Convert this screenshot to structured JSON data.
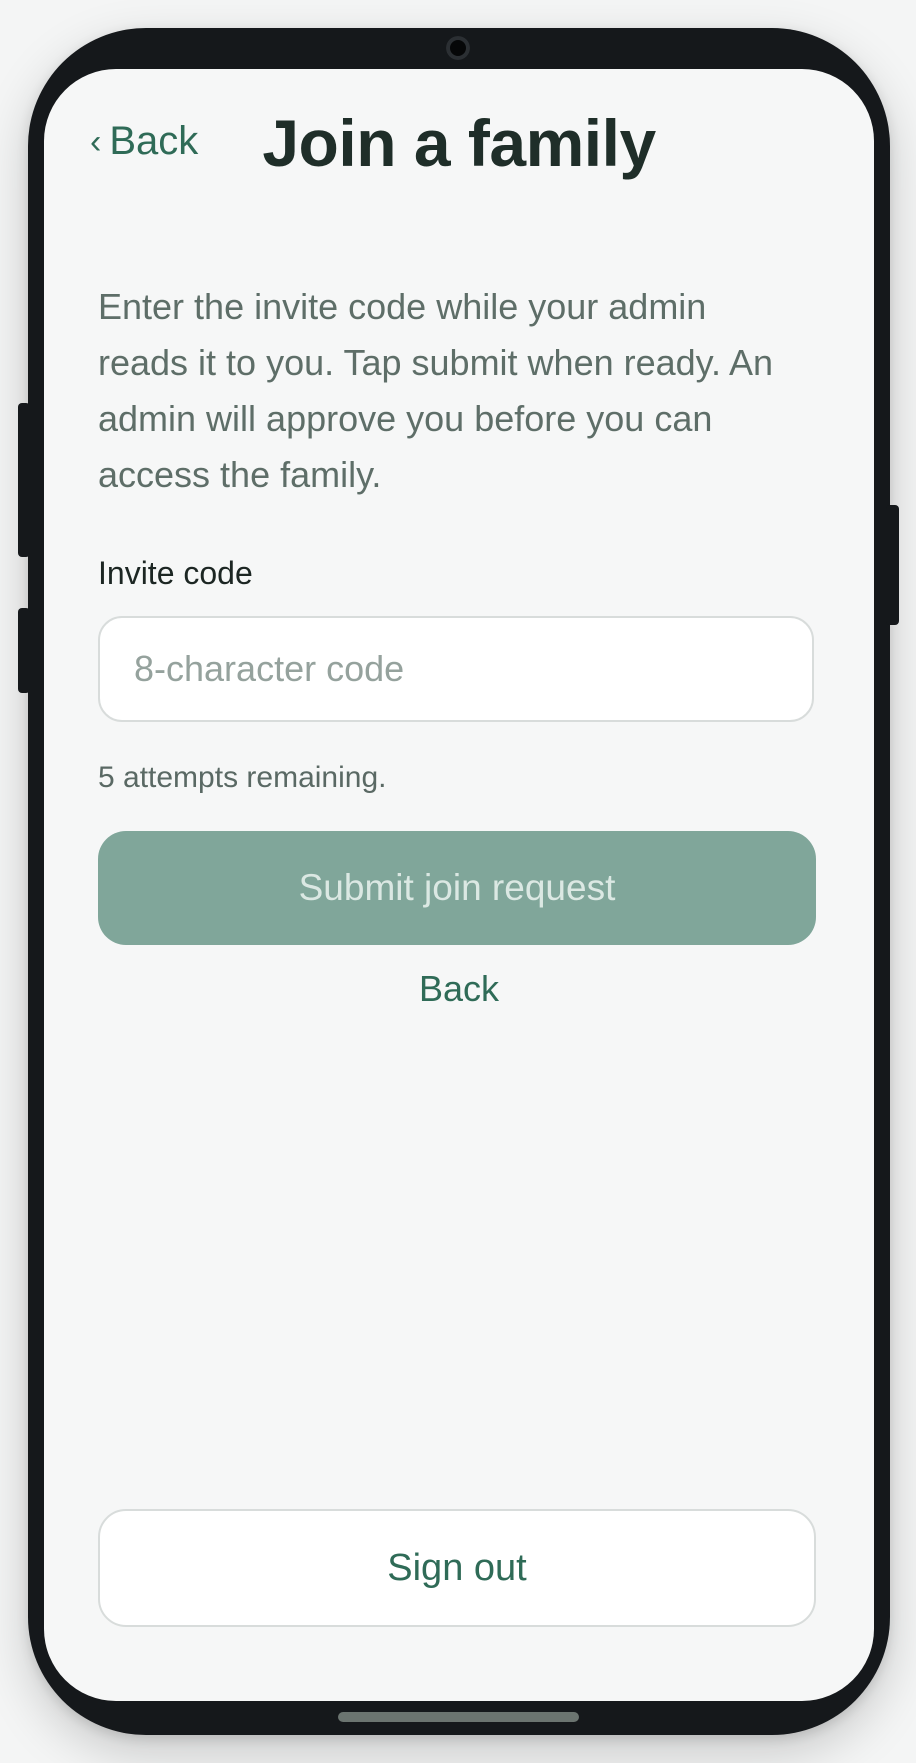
{
  "header": {
    "back_chevron": "‹",
    "back_label": "Back",
    "title": "Join a family"
  },
  "main": {
    "description": "Enter the invite code while your admin reads it to you. Tap submit when ready. An admin will approve you before you can access the family.",
    "invite_code": {
      "label": "Invite code",
      "value": "",
      "placeholder": "8-character code"
    },
    "attempts_text": "5 attempts remaining.",
    "submit_label": "Submit join request",
    "back_label": "Back"
  },
  "footer": {
    "sign_out_label": "Sign out"
  },
  "colors": {
    "accent": "#2f6b57",
    "submit_disabled": "#80a69a",
    "title": "#1f2e29"
  }
}
